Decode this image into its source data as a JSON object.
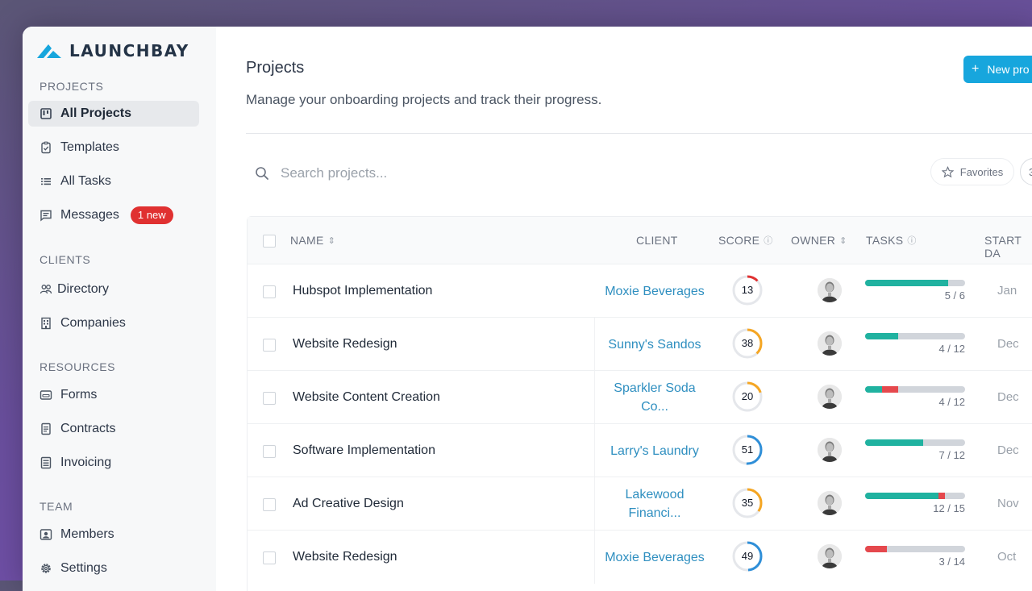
{
  "brand": {
    "name": "LAUNCHBAY",
    "color": "#17a6dd"
  },
  "sidebar": {
    "sections": [
      {
        "label": "PROJECTS",
        "items": [
          {
            "label": "All Projects",
            "icon": "projects-board-icon",
            "active": true
          },
          {
            "label": "Templates",
            "icon": "clipboard-icon"
          },
          {
            "label": "All Tasks",
            "icon": "list-icon"
          },
          {
            "label": "Messages",
            "icon": "message-icon",
            "badge": "1 new"
          }
        ]
      },
      {
        "label": "CLIENTS",
        "items": [
          {
            "label": "Directory",
            "icon": "users-icon"
          },
          {
            "label": "Companies",
            "icon": "building-icon"
          }
        ]
      },
      {
        "label": "RESOURCES",
        "items": [
          {
            "label": "Forms",
            "icon": "form-icon"
          },
          {
            "label": "Contracts",
            "icon": "document-icon"
          },
          {
            "label": "Invoicing",
            "icon": "invoice-icon"
          }
        ]
      },
      {
        "label": "TEAM",
        "items": [
          {
            "label": "Members",
            "icon": "member-card-icon"
          },
          {
            "label": "Settings",
            "icon": "gear-icon"
          }
        ]
      }
    ]
  },
  "header": {
    "title": "Projects",
    "subtitle": "Manage your onboarding projects and track their progress.",
    "new_button": "New pro"
  },
  "toolbar": {
    "search_placeholder": "Search projects...",
    "favorites_label": "Favorites",
    "extra_button": "3"
  },
  "table": {
    "columns": {
      "name": "NAME",
      "client": "CLIENT",
      "score": "SCORE",
      "owner": "OWNER",
      "tasks": "TASKS",
      "start": "START DA"
    },
    "rows": [
      {
        "name": "Hubspot Implementation",
        "client": [
          "Moxie Beverages"
        ],
        "score": 13,
        "score_color": "#e03131",
        "tasks_done": 5,
        "tasks_total": 6,
        "tasks_label": "5 / 6",
        "overdue": 0,
        "start": "Jan"
      },
      {
        "name": "Website Redesign",
        "client": [
          "Sunny's Sandos"
        ],
        "score": 38,
        "score_color": "#f5a623",
        "tasks_done": 4,
        "tasks_total": 12,
        "tasks_label": "4 / 12",
        "overdue": 0,
        "start": "Dec"
      },
      {
        "name": "Website Content Creation",
        "client": [
          "Sparkler Soda",
          "Co..."
        ],
        "score": 20,
        "score_color": "#f5a623",
        "tasks_done": 4,
        "tasks_total": 12,
        "tasks_label": "4 / 12",
        "overdue": 2,
        "start": "Dec"
      },
      {
        "name": "Software Implementation",
        "client": [
          "Larry's Laundry"
        ],
        "score": 51,
        "score_color": "#2f8fd8",
        "tasks_done": 7,
        "tasks_total": 12,
        "tasks_label": "7 / 12",
        "overdue": 0,
        "start": "Dec"
      },
      {
        "name": "Ad Creative Design",
        "client": [
          "Lakewood",
          "Financi..."
        ],
        "score": 35,
        "score_color": "#f5a623",
        "tasks_done": 12,
        "tasks_total": 15,
        "tasks_label": "12 / 15",
        "overdue": 1,
        "start": "Nov"
      },
      {
        "name": "Website Redesign",
        "client": [
          "Moxie Beverages"
        ],
        "score": 49,
        "score_color": "#2f8fd8",
        "tasks_done": 3,
        "tasks_total": 14,
        "tasks_label": "3 / 14",
        "overdue": 3,
        "start": "Oct"
      }
    ]
  },
  "colors": {
    "tasks_done": "#20b2a0",
    "tasks_overdue": "#e5484d",
    "tasks_remaining": "#d1d5db",
    "client_link": "#2f8fc0"
  }
}
